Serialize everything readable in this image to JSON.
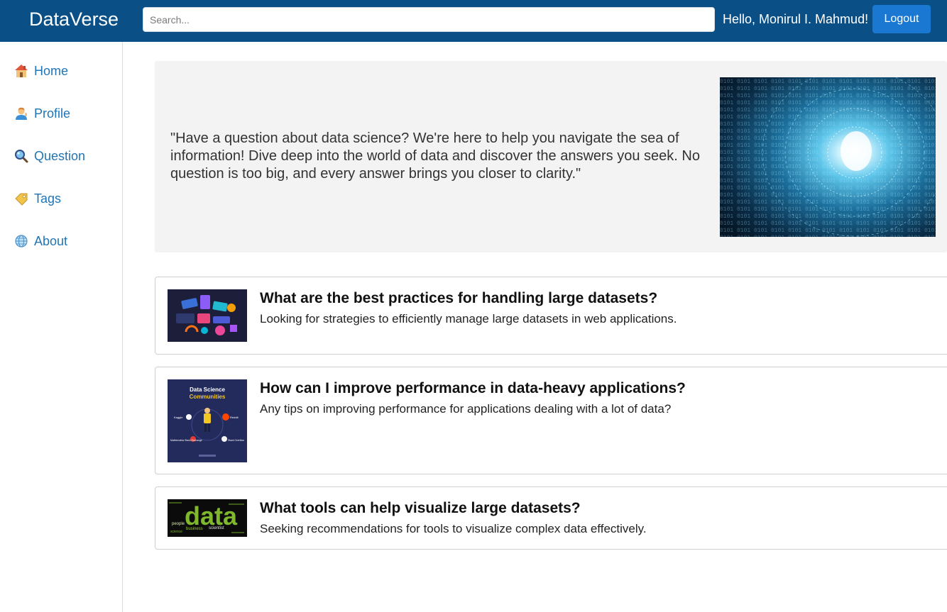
{
  "header": {
    "brand": "DataVerse",
    "search_placeholder": "Search...",
    "greeting": "Hello, Monirul I. Mahmud!",
    "logout_label": "Logout"
  },
  "sidebar": {
    "items": [
      {
        "label": "Home",
        "icon": "home-icon"
      },
      {
        "label": "Profile",
        "icon": "profile-icon"
      },
      {
        "label": "Question",
        "icon": "magnifier-icon"
      },
      {
        "label": "Tags",
        "icon": "tag-icon"
      },
      {
        "label": "About",
        "icon": "globe-icon"
      }
    ]
  },
  "hero": {
    "quote": "\"Have a question about data science? We're here to help you navigate the sea of information! Dive deep into the world of data and discover the answers you seek. No question is too big, and every answer brings you closer to clarity.\""
  },
  "questions": [
    {
      "title": "What are the best practices for handling large datasets?",
      "description": "Looking for strategies to efficiently manage large datasets in web applications."
    },
    {
      "title": "How can I improve performance in data-heavy applications?",
      "description": "Any tips on improving performance for applications dealing with a lot of data?",
      "thumbnail": {
        "title": "Data Science",
        "subtitle": "Communities",
        "labels": [
          "Kaggle",
          "Reddit",
          "Mathematics Stack Exchange",
          "Stack Overflow"
        ]
      }
    },
    {
      "title": "What tools can help visualize large datasets?",
      "description": "Seeking recommendations for tools to visualize complex data effectively.",
      "thumbnail": {
        "word": "data",
        "small_words": [
          "people",
          "business",
          "scientist",
          "science"
        ]
      }
    }
  ],
  "colors": {
    "header_bg": "#0a4f86",
    "accent": "#1a78d2",
    "link": "#2175b4",
    "hero_bg": "#f3f3f3"
  }
}
